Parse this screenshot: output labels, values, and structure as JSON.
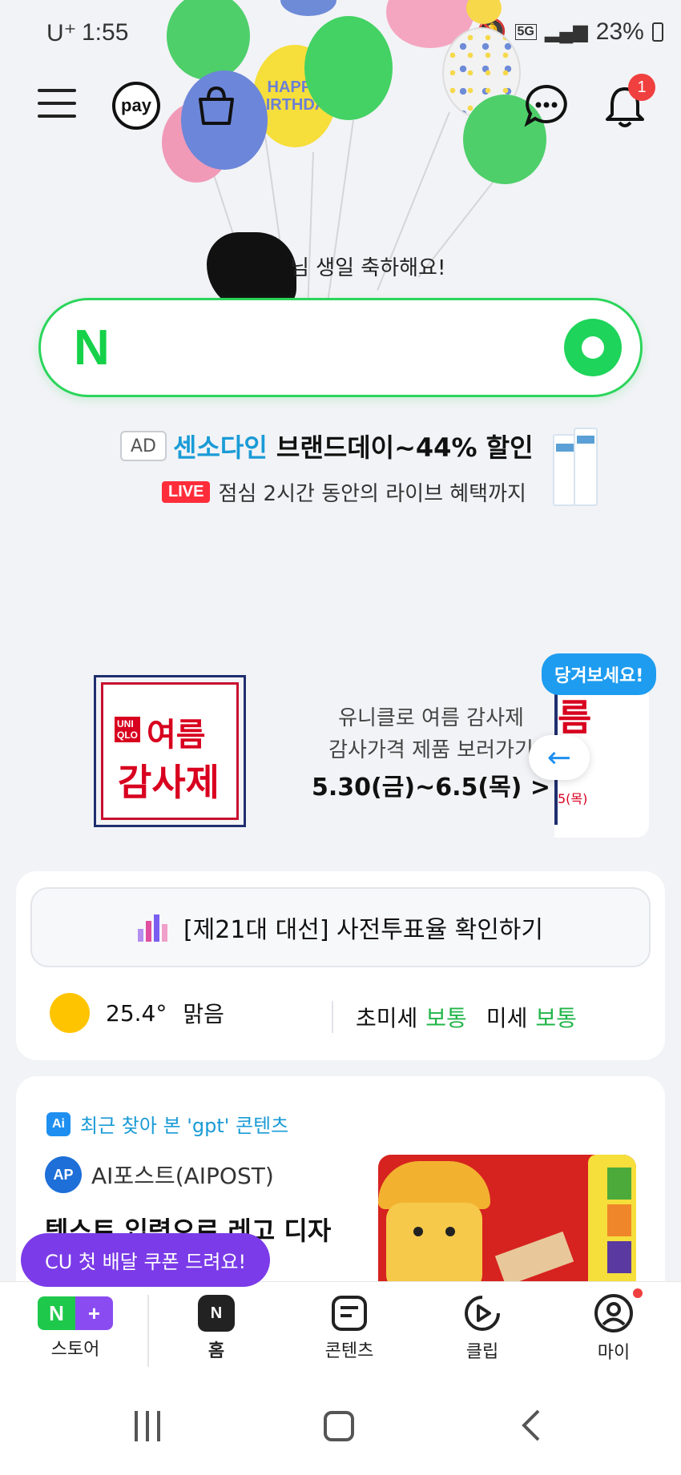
{
  "status_bar": {
    "carrier": "U⁺",
    "time": "1:55",
    "network": "5G",
    "battery": "23%"
  },
  "header": {
    "pay_label": "pay",
    "notification_count": "1"
  },
  "greeting": {
    "suffix": "님 생일 축하해요!"
  },
  "search": {
    "logo": "N"
  },
  "ad": {
    "tag": "AD",
    "brand": "센소다인",
    "headline": "브랜드데이~44% 할인",
    "live_tag": "LIVE",
    "subline": "점심 2시간 동안의 라이브 혜택까지"
  },
  "uniqlo_banner": {
    "logo_mini": "UNI\nQLO",
    "logo_title1": "여름",
    "logo_title2": "감사제",
    "line1": "유니클로 여름 감사제",
    "line2": "감사가격 제품 보러가기",
    "dates": "5.30(금)~6.5(목) >",
    "pull_hint": "당겨보세요!",
    "peek_text": "름",
    "peek_date": "5(목)"
  },
  "election": {
    "label": "[제21대 대선] 사전투표율 확인하기"
  },
  "weather": {
    "temp": "25.4°",
    "condition": "맑음",
    "fine_dust_label": "초미세",
    "fine_dust_value": "보통",
    "dust_label": "미세",
    "dust_value": "보통"
  },
  "recent": {
    "ai_badge": "Ai",
    "title": "최근 찾아 본 'gpt' 콘텐츠",
    "source_logo": "AP",
    "source": "AI포스트(AIPOST)",
    "headline": "텍스트 입력으로 레고 디자"
  },
  "promo": {
    "cu_label": "CU 첫 배달 쿠폰 드려요!"
  },
  "bottom_nav": {
    "store": "스토어",
    "home": "홈",
    "content": "콘텐츠",
    "clip": "클립",
    "my": "마이"
  },
  "colors": {
    "naver_green": "#17d14a",
    "brand_blue": "#1a9bd6",
    "promo_purple": "#7b3be8",
    "status_green": "#22b54a"
  }
}
